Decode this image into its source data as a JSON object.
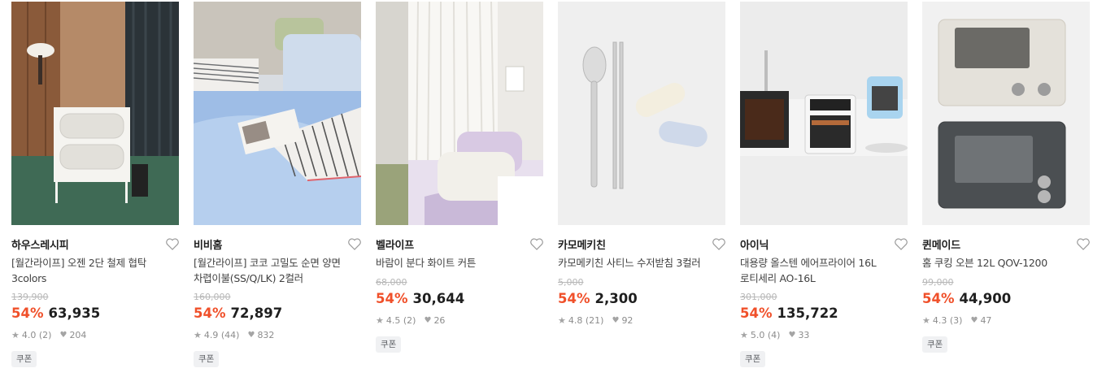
{
  "products": [
    {
      "brand": "하우스레시피",
      "title": "[월간라이프] 오젠 2단 철제 협탁\n3colors",
      "original_price": "139,900",
      "discount": "54%",
      "price": "63,935",
      "rating": "4.0",
      "reviews": "(2)",
      "likes": "204",
      "coupon": "쿠폰",
      "image_icon": "nightstand-photo"
    },
    {
      "brand": "비비홈",
      "title": "[월간라이프] 코코 고밀도 순면 양면\n차렵이불(SS/Q/LK) 2컬러",
      "original_price": "160,000",
      "discount": "54%",
      "price": "72,897",
      "rating": "4.9",
      "reviews": "(44)",
      "likes": "832",
      "coupon": "쿠폰",
      "image_icon": "bedding-photo"
    },
    {
      "brand": "벨라이프",
      "title": "바람이 분다 화이트 커튼",
      "original_price": "68,000",
      "discount": "54%",
      "price": "30,644",
      "rating": "4.5",
      "reviews": "(2)",
      "likes": "26",
      "coupon": "쿠폰",
      "image_icon": "curtain-photo"
    },
    {
      "brand": "카모메키친",
      "title": "카모메키친 사티느 수저받침 3컬러",
      "original_price": "5,000",
      "discount": "54%",
      "price": "2,300",
      "rating": "4.8",
      "reviews": "(21)",
      "likes": "92",
      "coupon": "",
      "image_icon": "cutlery-rest-photo"
    },
    {
      "brand": "아이닉",
      "title": "대용량 올스텐 에어프라이어 16L\n로티세리 AO-16L",
      "original_price": "301,000",
      "discount": "54%",
      "price": "135,722",
      "rating": "5.0",
      "reviews": "(4)",
      "likes": "33",
      "coupon": "쿠폰",
      "image_icon": "air-fryer-photo"
    },
    {
      "brand": "퀸메이드",
      "title": "홈 쿠킹 오븐 12L QOV-1200",
      "original_price": "99,000",
      "discount": "54%",
      "price": "44,900",
      "rating": "4.3",
      "reviews": "(3)",
      "likes": "47",
      "coupon": "쿠폰",
      "image_icon": "toaster-oven-photo"
    }
  ],
  "colors": {
    "discount": "#f0502a",
    "price": "#1f1f1f",
    "muted": "#8c8c8c",
    "strike": "#b7b7b7",
    "coupon_bg": "#f0f1f3"
  }
}
